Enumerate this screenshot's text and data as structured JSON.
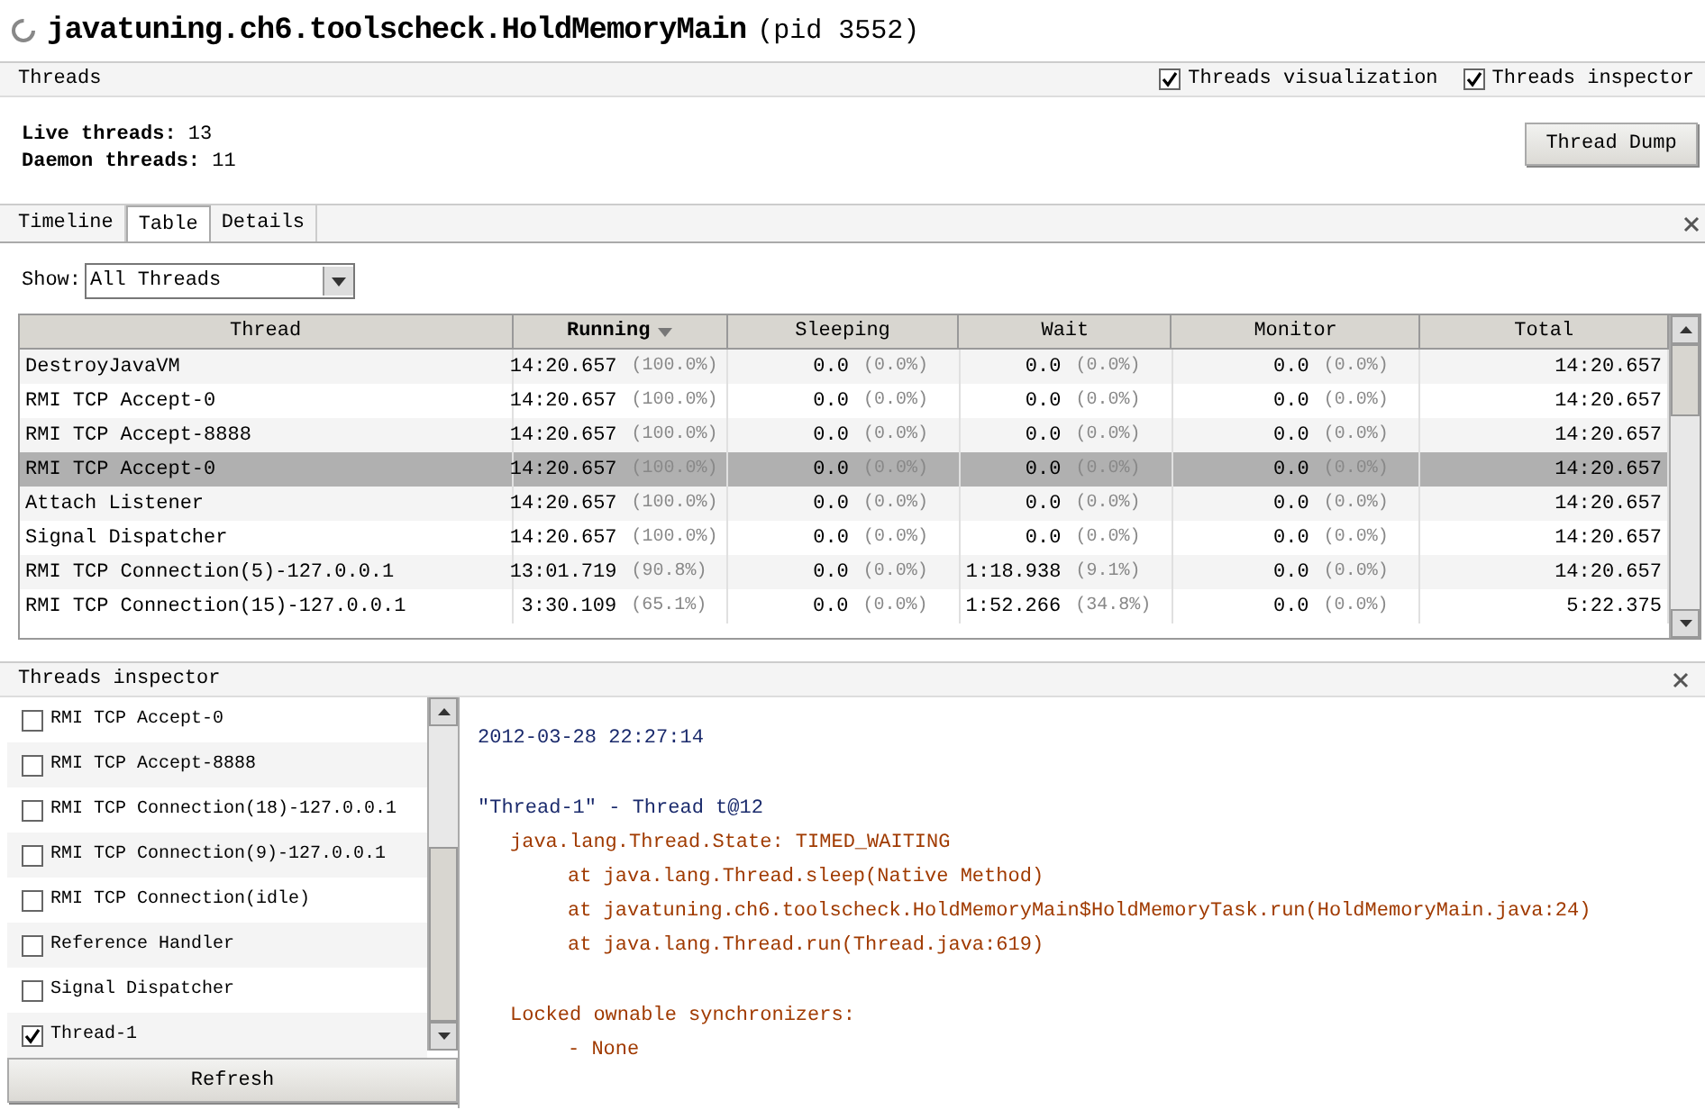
{
  "window": {
    "title": "javatuning.ch6.toolscheck.HoldMemoryMain",
    "pid": "(pid 3552)"
  },
  "threads_bar": {
    "title": "Threads",
    "options": [
      {
        "label": "Threads visualization",
        "checked": true
      },
      {
        "label": "Threads inspector",
        "checked": true
      }
    ]
  },
  "stats": [
    {
      "label": "Live threads:",
      "value": "13"
    },
    {
      "label": "Daemon threads:",
      "value": "11"
    }
  ],
  "thread_dump_button": "Thread Dump",
  "tabs": [
    {
      "label": "Timeline",
      "selected": false
    },
    {
      "label": "Table",
      "selected": true
    },
    {
      "label": "Details",
      "selected": false
    }
  ],
  "show": {
    "label": "Show:",
    "value": "All Threads"
  },
  "table": {
    "columns": [
      {
        "label": "Thread",
        "sorted": false
      },
      {
        "label": "Running",
        "sorted": true
      },
      {
        "label": "Sleeping",
        "sorted": false
      },
      {
        "label": "Wait",
        "sorted": false
      },
      {
        "label": "Monitor",
        "sorted": false
      },
      {
        "label": "Total",
        "sorted": false
      }
    ],
    "rows": [
      {
        "thread": "DestroyJavaVM",
        "running": [
          "14:20.657",
          "(100.0%)"
        ],
        "sleeping": [
          "0.0",
          "(0.0%)"
        ],
        "wait": [
          "0.0",
          "(0.0%)"
        ],
        "monitor": [
          "0.0",
          "(0.0%)"
        ],
        "total": "14:20.657",
        "selected": false
      },
      {
        "thread": "RMI TCP Accept-0",
        "running": [
          "14:20.657",
          "(100.0%)"
        ],
        "sleeping": [
          "0.0",
          "(0.0%)"
        ],
        "wait": [
          "0.0",
          "(0.0%)"
        ],
        "monitor": [
          "0.0",
          "(0.0%)"
        ],
        "total": "14:20.657",
        "selected": false
      },
      {
        "thread": "RMI TCP Accept-8888",
        "running": [
          "14:20.657",
          "(100.0%)"
        ],
        "sleeping": [
          "0.0",
          "(0.0%)"
        ],
        "wait": [
          "0.0",
          "(0.0%)"
        ],
        "monitor": [
          "0.0",
          "(0.0%)"
        ],
        "total": "14:20.657",
        "selected": false
      },
      {
        "thread": "RMI TCP Accept-0",
        "running": [
          "14:20.657",
          "(100.0%)"
        ],
        "sleeping": [
          "0.0",
          "(0.0%)"
        ],
        "wait": [
          "0.0",
          "(0.0%)"
        ],
        "monitor": [
          "0.0",
          "(0.0%)"
        ],
        "total": "14:20.657",
        "selected": true
      },
      {
        "thread": "Attach Listener",
        "running": [
          "14:20.657",
          "(100.0%)"
        ],
        "sleeping": [
          "0.0",
          "(0.0%)"
        ],
        "wait": [
          "0.0",
          "(0.0%)"
        ],
        "monitor": [
          "0.0",
          "(0.0%)"
        ],
        "total": "14:20.657",
        "selected": false
      },
      {
        "thread": "Signal Dispatcher",
        "running": [
          "14:20.657",
          "(100.0%)"
        ],
        "sleeping": [
          "0.0",
          "(0.0%)"
        ],
        "wait": [
          "0.0",
          "(0.0%)"
        ],
        "monitor": [
          "0.0",
          "(0.0%)"
        ],
        "total": "14:20.657",
        "selected": false
      },
      {
        "thread": "RMI TCP Connection(5)-127.0.0.1",
        "running": [
          "13:01.719",
          "(90.8%)"
        ],
        "sleeping": [
          "0.0",
          "(0.0%)"
        ],
        "wait": [
          "1:18.938",
          "(9.1%)"
        ],
        "monitor": [
          "0.0",
          "(0.0%)"
        ],
        "total": "14:20.657",
        "selected": false
      },
      {
        "thread": "RMI TCP Connection(15)-127.0.0.1",
        "running": [
          "3:30.109",
          "(65.1%)"
        ],
        "sleeping": [
          "0.0",
          "(0.0%)"
        ],
        "wait": [
          "1:52.266",
          "(34.8%)"
        ],
        "monitor": [
          "0.0",
          "(0.0%)"
        ],
        "total": "5:22.375",
        "selected": false
      }
    ]
  },
  "inspector": {
    "title": "Threads inspector",
    "items": [
      {
        "label": "RMI TCP Accept-0",
        "checked": false
      },
      {
        "label": "RMI TCP Accept-8888",
        "checked": false
      },
      {
        "label": "RMI TCP Connection(18)-127.0.0.1",
        "checked": false
      },
      {
        "label": "RMI TCP Connection(9)-127.0.0.1",
        "checked": false
      },
      {
        "label": "RMI TCP Connection(idle)",
        "checked": false
      },
      {
        "label": "Reference Handler",
        "checked": false
      },
      {
        "label": "Signal Dispatcher",
        "checked": false
      },
      {
        "label": "Thread-1",
        "checked": true
      }
    ],
    "refresh_button": "Refresh"
  },
  "detail": [
    {
      "kind": "timestamp",
      "text": "2012-03-28 22:27:14"
    },
    {
      "kind": "header",
      "text": "\"Thread-1\" - Thread t@12"
    },
    {
      "kind": "state",
      "text": "java.lang.Thread.State: TIMED_WAITING"
    },
    {
      "kind": "frame",
      "text": "at java.lang.Thread.sleep(Native Method)"
    },
    {
      "kind": "frame",
      "text": "at javatuning.ch6.toolscheck.HoldMemoryMain$HoldMemoryTask.run(HoldMemoryMain.java:24)"
    },
    {
      "kind": "frame",
      "text": "at java.lang.Thread.run(Thread.java:619)"
    },
    {
      "kind": "section",
      "text": "Locked ownable synchronizers:"
    },
    {
      "kind": "item",
      "text": "- None"
    }
  ]
}
